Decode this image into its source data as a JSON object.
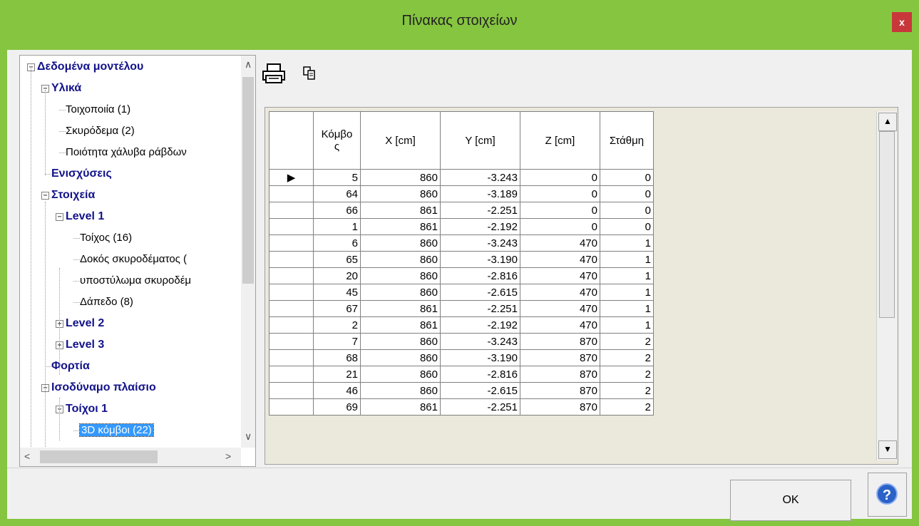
{
  "window": {
    "title": "Πίνακας στοιχείων",
    "close_label": "x"
  },
  "tree": {
    "nodes": [
      {
        "label": "Δεδομένα μοντέλου",
        "bold": true,
        "level": 0,
        "expander": "−"
      },
      {
        "label": "Υλικά",
        "bold": true,
        "level": 1,
        "expander": "−"
      },
      {
        "label": "Τοιχοποιία (1)",
        "bold": false,
        "level": 2,
        "expander": ""
      },
      {
        "label": "Σκυρόδεμα (2)",
        "bold": false,
        "level": 2,
        "expander": ""
      },
      {
        "label": "Ποιότητα χάλυβα ράβδων",
        "bold": false,
        "level": 2,
        "expander": ""
      },
      {
        "label": "Ενισχύσεις",
        "bold": true,
        "level": 1,
        "expander": ""
      },
      {
        "label": "Στοιχεία",
        "bold": true,
        "level": 1,
        "expander": "−"
      },
      {
        "label": "Level 1",
        "bold": true,
        "level": 2,
        "expander": "−"
      },
      {
        "label": "Τοίχος (16)",
        "bold": false,
        "level": 3,
        "expander": ""
      },
      {
        "label": "Δοκός σκυροδέματος (",
        "bold": false,
        "level": 3,
        "expander": ""
      },
      {
        "label": "υποστύλωμα σκυροδέμ",
        "bold": false,
        "level": 3,
        "expander": ""
      },
      {
        "label": "Δάπεδο (8)",
        "bold": false,
        "level": 3,
        "expander": ""
      },
      {
        "label": "Level 2",
        "bold": true,
        "level": 2,
        "expander": "+"
      },
      {
        "label": "Level 3",
        "bold": true,
        "level": 2,
        "expander": "+"
      },
      {
        "label": "Φορτία",
        "bold": true,
        "level": 1,
        "expander": ""
      },
      {
        "label": "Ισοδύναμο πλαίσιο",
        "bold": true,
        "level": 1,
        "expander": "−"
      },
      {
        "label": "Τοίχοι 1",
        "bold": true,
        "level": 2,
        "expander": "−"
      },
      {
        "label": "3D κόμβοι (22)",
        "bold": false,
        "level": 3,
        "expander": "",
        "selected": true
      }
    ]
  },
  "toolbar": {
    "print_icon": "printer-icon",
    "copy_icon": "copy-icon"
  },
  "grid": {
    "columns": [
      "Κόμβο\nς",
      "X [cm]",
      "Y [cm]",
      "Z [cm]",
      "Στάθμη"
    ],
    "current_row_marker": "▶",
    "rows": [
      [
        "5",
        "860",
        "-3.243",
        "0",
        "0"
      ],
      [
        "64",
        "860",
        "-3.189",
        "0",
        "0"
      ],
      [
        "66",
        "861",
        "-2.251",
        "0",
        "0"
      ],
      [
        "1",
        "861",
        "-2.192",
        "0",
        "0"
      ],
      [
        "6",
        "860",
        "-3.243",
        "470",
        "1"
      ],
      [
        "65",
        "860",
        "-3.190",
        "470",
        "1"
      ],
      [
        "20",
        "860",
        "-2.816",
        "470",
        "1"
      ],
      [
        "45",
        "860",
        "-2.615",
        "470",
        "1"
      ],
      [
        "67",
        "861",
        "-2.251",
        "470",
        "1"
      ],
      [
        "2",
        "861",
        "-2.192",
        "470",
        "1"
      ],
      [
        "7",
        "860",
        "-3.243",
        "870",
        "2"
      ],
      [
        "68",
        "860",
        "-3.190",
        "870",
        "2"
      ],
      [
        "21",
        "860",
        "-2.816",
        "870",
        "2"
      ],
      [
        "46",
        "860",
        "-2.615",
        "870",
        "2"
      ],
      [
        "69",
        "861",
        "-2.251",
        "870",
        "2"
      ]
    ]
  },
  "buttons": {
    "ok": "OK",
    "help": "?"
  },
  "colors": {
    "frame": "#86c540",
    "close": "#c8383a",
    "selection": "#3399ff",
    "tree_bold": "#12128a"
  }
}
